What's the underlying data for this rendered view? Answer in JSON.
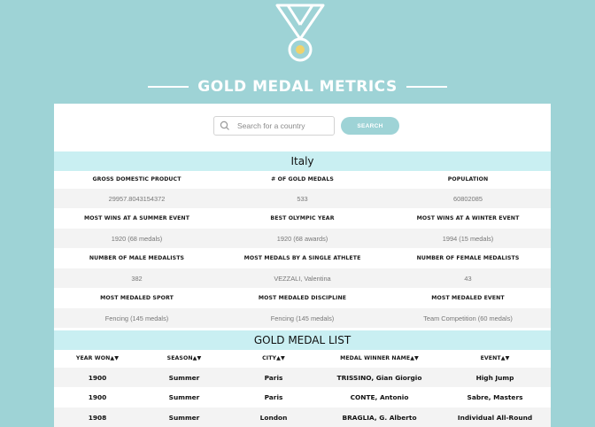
{
  "colors": {
    "background": "#9ed3d6",
    "band": "#c9eff2",
    "button": "#9ed3d6"
  },
  "header": {
    "logo_icon": "medal-icon",
    "title": "GOLD MEDAL METRICS"
  },
  "search": {
    "placeholder": "Search for a country",
    "button_label": "SEARCH"
  },
  "country": {
    "name": "Italy",
    "rows": [
      {
        "labels": [
          "GROSS DOMESTIC PRODUCT",
          "# OF GOLD MEDALS",
          "POPULATION"
        ],
        "values": [
          "29957.8043154372",
          "533",
          "60802085"
        ]
      },
      {
        "labels": [
          "MOST WINS AT A SUMMER EVENT",
          "BEST OLYMPIC YEAR",
          "MOST WINS AT A WINTER EVENT"
        ],
        "values": [
          "1920 (68 medals)",
          "1920 (68 awards)",
          "1994 (15 medals)"
        ]
      },
      {
        "labels": [
          "NUMBER OF MALE MEDALISTS",
          "MOST MEDALS BY A SINGLE ATHLETE",
          "NUMBER OF FEMALE MEDALISTS"
        ],
        "values": [
          "382",
          "VEZZALI, Valentina",
          "43"
        ]
      },
      {
        "labels": [
          "MOST MEDALED SPORT",
          "MOST MEDALED DISCIPLINE",
          "MOST MEDALED EVENT"
        ],
        "values": [
          "Fencing (145 medals)",
          "Fencing (145 medals)",
          "Team Competition (60 medals)"
        ]
      }
    ]
  },
  "medal_list": {
    "title": "GOLD MEDAL LIST",
    "sort_glyph": "▲▼",
    "columns": [
      "YEAR WON",
      "SEASON",
      "CITY",
      "MEDAL WINNER NAME",
      "EVENT"
    ],
    "rows": [
      [
        "1900",
        "Summer",
        "Paris",
        "TRISSINO, Gian Giorgio",
        "High Jump"
      ],
      [
        "1900",
        "Summer",
        "Paris",
        "CONTE, Antonio",
        "Sabre, Masters"
      ],
      [
        "1908",
        "Summer",
        "London",
        "BRAGLIA, G. Alberto",
        "Individual All-Round"
      ]
    ]
  }
}
